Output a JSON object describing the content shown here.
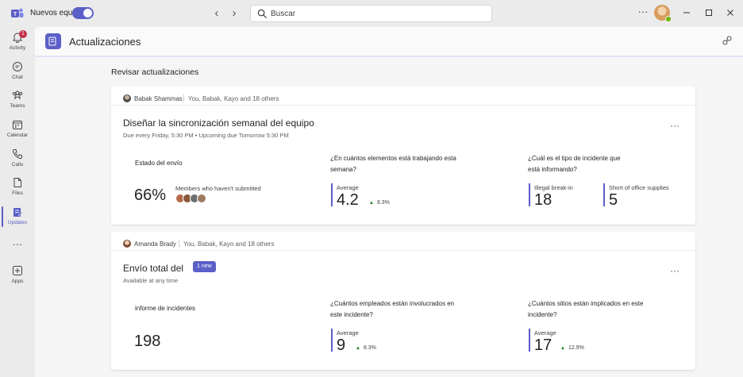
{
  "titlebar": {
    "new_teams_label": "Nuevos equipos",
    "search_placeholder": "Buscar",
    "more": "···"
  },
  "rail": {
    "items": [
      {
        "label": "Activity",
        "badge": "1"
      },
      {
        "label": "Chat"
      },
      {
        "label": "Teams"
      },
      {
        "label": "Calendar"
      },
      {
        "label": "Calls"
      },
      {
        "label": "Files"
      },
      {
        "label": "Updates"
      },
      {
        "label": "Apps"
      }
    ],
    "more": "···"
  },
  "app": {
    "title": "Actualizaciones",
    "section_title": "Revisar actualizaciones"
  },
  "cards": [
    {
      "owner": "Babak Shammas",
      "audience": "You, Babak, Kayo and 18 others",
      "title": "Diseñar la sincronización semanal del equipo",
      "subtitle": "Due every Friday, 5:30 PM • Upcoming due Tomorrow 5:30 PM",
      "more": "···",
      "status_label": "Estado del envío",
      "status_value": "66%",
      "members_label": "Members who haven't submitted",
      "q2": {
        "label": "¿En cuántos elementos está trabajando esta semana?",
        "caption": "Average",
        "value": "4.2",
        "trend": "8.3%"
      },
      "q3": {
        "label": "¿Cuál es el tipo de incidente que está informando?",
        "opt1_caption": "Illegal break-in",
        "opt1_value": "18",
        "opt2_caption": "Short of office supplies",
        "opt2_value": "5"
      }
    },
    {
      "owner": "Amanda Brady",
      "audience": "You, Babak, Kayo and 18 others",
      "title": "Envío total del",
      "badge": "1 new",
      "subtitle": "Available at any time",
      "more": "···",
      "report_label": "informe de incidentes",
      "report_value": "198",
      "q2": {
        "label": "¿Cuántos empleados están involucrados en este incidente?",
        "caption": "Average",
        "value": "9",
        "trend": "8.3%"
      },
      "q3": {
        "label": "¿Cuántos sitios están implicados en este incidente?",
        "caption": "Average",
        "value": "17",
        "trend": "12.9%"
      }
    }
  ],
  "colors": {
    "accent": "#5b5fc7",
    "trend_up": "#107c10",
    "badge_red": "#c4314b"
  }
}
